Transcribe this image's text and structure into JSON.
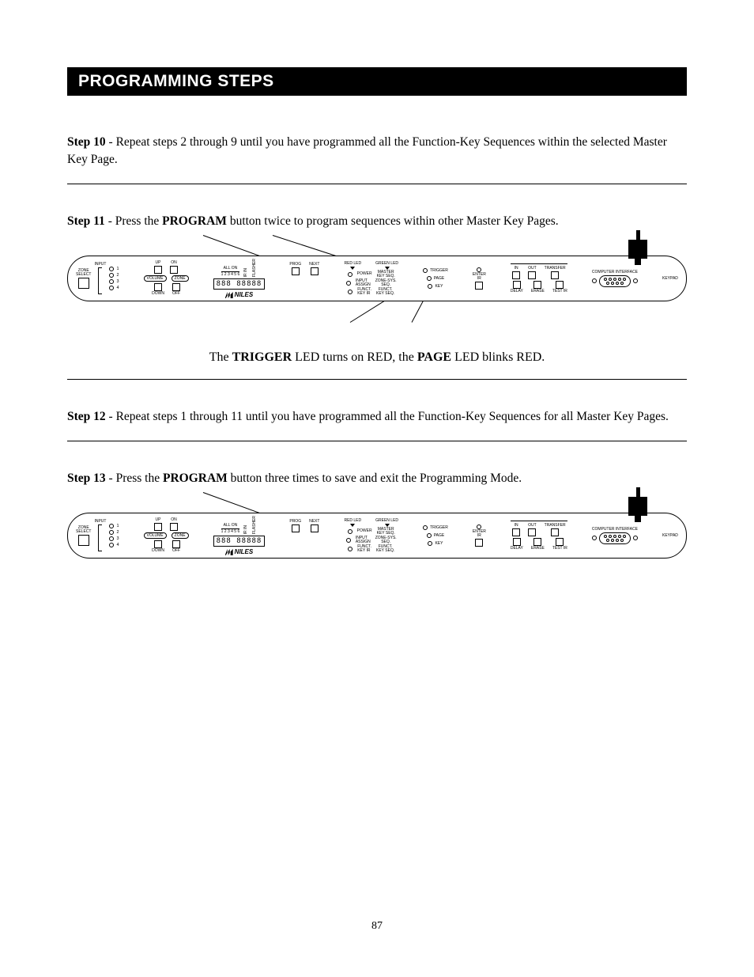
{
  "header": "PROGRAMMING STEPS",
  "steps": {
    "s10": {
      "label": "Step 10",
      "text": " - Repeat steps 2 through 9 until you have programmed all the Function-Key Sequences within the selected Master Key Page."
    },
    "s11": {
      "label": "Step 11",
      "prefix": " - Press the ",
      "bold": "PROGRAM",
      "suffix": " button twice to program sequences within other Master Key Pages."
    },
    "s12": {
      "label": "Step 12",
      "text": " - Repeat steps 1 through 11 until you have programmed all the Function-Key Sequences for all Master Key Pages."
    },
    "s13": {
      "label": "Step 13",
      "prefix": " - Press the ",
      "bold": "PROGRAM",
      "suffix": " button three times to save and exit the Programming Mode."
    }
  },
  "caption": {
    "pre": "The ",
    "b1": "TRIGGER",
    "mid": " LED turns on RED, the ",
    "b2": "PAGE",
    "post": " LED blinks RED."
  },
  "panel": {
    "zone_select": "ZONE\nSELECT",
    "input": "INPUT",
    "nums": [
      "1",
      "2",
      "3",
      "4"
    ],
    "up": "UP",
    "on": "ON",
    "down": "DOWN",
    "off": "OFF",
    "volume": "VOLUME",
    "zone": "ZONE",
    "all_on": "ALL ON",
    "all_on_nums": "1 2 3 4 5 6",
    "ir_in": "IR IN",
    "flasher": "FLASHER",
    "prog": "PROG",
    "next": "NEXT",
    "display": "888 88888",
    "brand": "NILES",
    "red_led": "RED LED",
    "green_led": "GREEN LED",
    "power": "POWER",
    "master_key_seq": "MASTER\nKEY SEQ.",
    "input_assign": "INPUT\nASSIGN",
    "zone_sys_seq": "ZONE-SYS.\nSEQ.",
    "funct_key_ir": "FUNCT.\nKEY IR",
    "funct_key_seq": "FUNCT.\nKEY SEQ.",
    "trigger": "TRIGGER",
    "page": "PAGE",
    "key": "KEY",
    "enter_ir": "ENTER\nIR",
    "in": "IN",
    "out": "OUT",
    "transfer": "TRANSFER",
    "delay": "DELAY",
    "erase": "ERASE",
    "test_ir": "TEST IR",
    "computer_interface": "COMPUTER INTERFACE",
    "keypad": "KEYPAD"
  },
  "page_number": "87"
}
